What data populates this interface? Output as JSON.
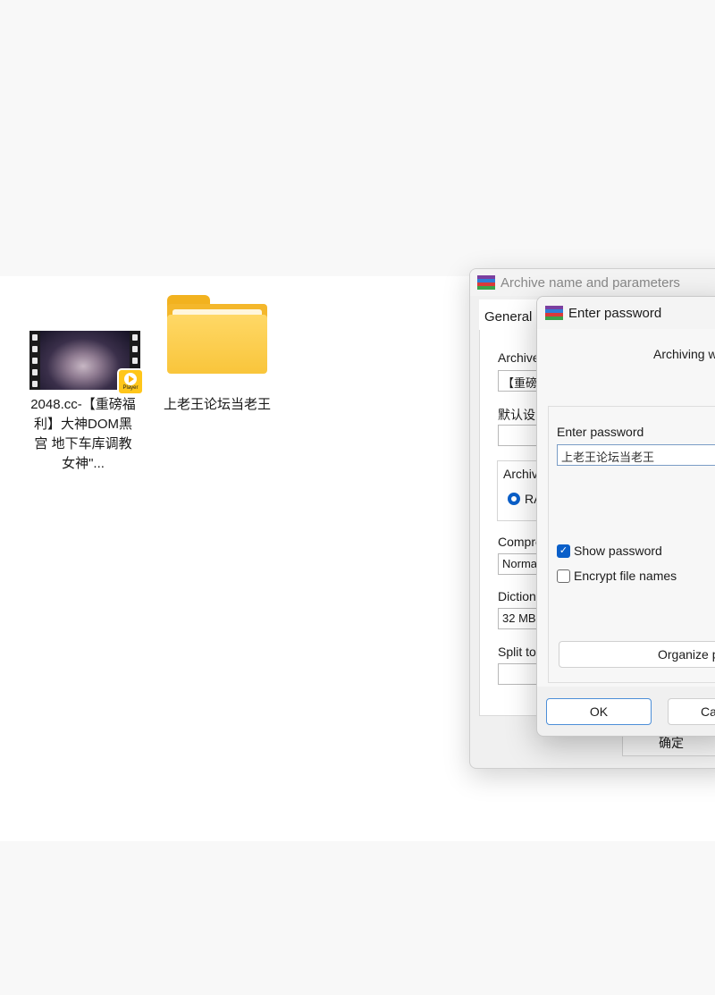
{
  "desktop": {
    "items": [
      {
        "label": "2048.cc-【重磅福利】大神DOM黑宫 地下车库调教女神\"...",
        "icon": "video-file-icon",
        "badge": "Player"
      },
      {
        "label": "上老王论坛当老王",
        "icon": "folder-icon"
      }
    ]
  },
  "archive_dialog": {
    "title": "Archive name and parameters",
    "tab": "General",
    "archive_name_label": "Archive",
    "archive_name_value": "【重磅",
    "profile_label": "默认设",
    "format_group_label": "Archiv",
    "format_option": "RA",
    "compression_label": "Compre",
    "compression_value": "Norma",
    "dictionary_label": "Dictiona",
    "dictionary_value": "32 MB",
    "split_label": "Split to",
    "ok_button": "确定"
  },
  "password_dialog": {
    "title": "Enter password",
    "archiving_text": "Archiving w",
    "password_label": "Enter password",
    "password_value": "上老王论坛当老王",
    "show_password_label": "Show password",
    "show_password_checked": true,
    "encrypt_names_label": "Encrypt file names",
    "encrypt_names_checked": false,
    "organize_button": "Organize p",
    "ok_button": "OK",
    "cancel_button": "Ca",
    "accent_color": "#0a5fc9"
  }
}
